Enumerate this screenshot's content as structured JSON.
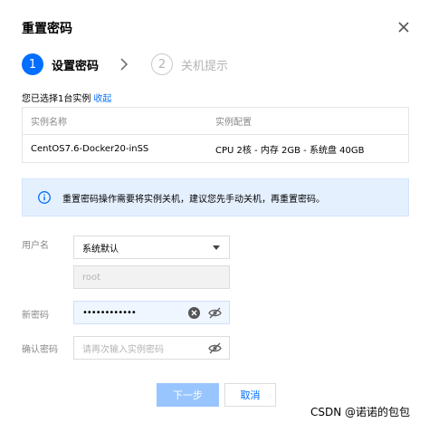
{
  "dialog": {
    "title": "重置密码"
  },
  "steps": [
    {
      "number": "1",
      "label": "设置密码",
      "state": "active"
    },
    {
      "number": "2",
      "label": "关机提示",
      "state": "inactive"
    }
  ],
  "selection": {
    "text": "您已选择1台实例",
    "collapse_label": "收起"
  },
  "table": {
    "headers": [
      "实例名称",
      "实例配置"
    ],
    "rows": [
      [
        "CentOS7.6-Docker20-inSS",
        "CPU 2核 - 内存 2GB - 系统盘 40GB"
      ]
    ]
  },
  "info": {
    "text": "重置密码操作需要将实例关机，建议您先手动关机，再重置密码。"
  },
  "form": {
    "username_label": "用户名",
    "username_select_value": "系统默认",
    "username_input_value": "root",
    "new_password_label": "新密码",
    "new_password_mask": "••••••••••••",
    "confirm_password_label": "确认密码",
    "confirm_password_placeholder": "请再次输入实例密码"
  },
  "buttons": {
    "next_label": "下一步",
    "cancel_label": "取消"
  },
  "watermark": "CSDN @诺诺的包包",
  "colors": {
    "primary": "#006eff",
    "info_bg": "#e5f0ff",
    "disabled_button": "#99c5ff"
  }
}
